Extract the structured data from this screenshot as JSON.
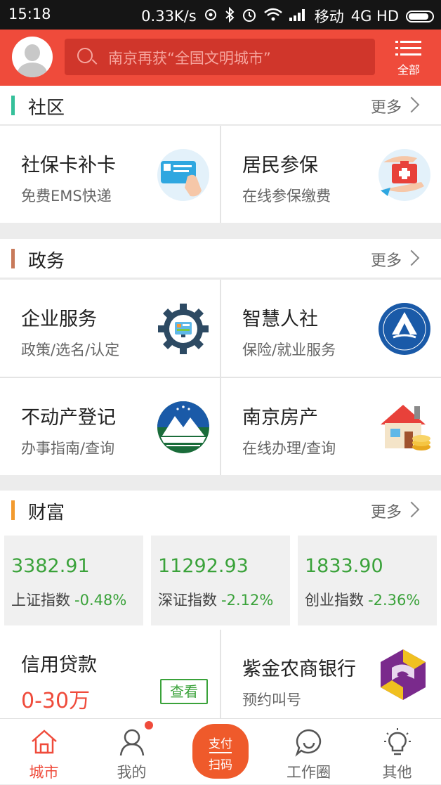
{
  "status_bar": {
    "time": "15:18",
    "net_speed": "0.33K/s",
    "carrier": "移动",
    "network": "4G HD"
  },
  "header": {
    "search_placeholder": "南京再获“全国文明城市”",
    "all_label": "全部"
  },
  "colors": {
    "brand": "#ef4b3b",
    "green": "#3aa23a",
    "orange": "#ef5a2b"
  },
  "community": {
    "title": "社区",
    "more": "更多",
    "tiles": [
      {
        "title": "社保卡补卡",
        "sub": "免费EMS快递",
        "icon": "card-hand-icon"
      },
      {
        "title": "居民参保",
        "sub": "在线参保缴费",
        "icon": "first-aid-hands-icon"
      }
    ]
  },
  "government": {
    "title": "政务",
    "more": "更多",
    "tiles": [
      {
        "title": "企业服务",
        "sub": "政策/选名/认定",
        "icon": "gear-icon"
      },
      {
        "title": "智慧人社",
        "sub": "保险/就业服务",
        "icon": "hrss-logo-icon"
      },
      {
        "title": "不动产登记",
        "sub": "办事指南/查询",
        "icon": "land-registry-logo-icon"
      },
      {
        "title": "南京房产",
        "sub": "在线办理/查询",
        "icon": "house-coins-icon"
      }
    ]
  },
  "wealth": {
    "title": "财富",
    "more": "更多",
    "indices": [
      {
        "value": "3382.91",
        "name": "上证指数",
        "change": "-0.48%"
      },
      {
        "value": "11292.93",
        "name": "深证指数",
        "change": "-2.12%"
      },
      {
        "value": "1833.90",
        "name": "创业指数",
        "change": "-2.36%"
      }
    ],
    "loan": {
      "title": "信用贷款",
      "amount": "0-30万",
      "button": "查看"
    },
    "bank": {
      "title": "紫金农商银行",
      "sub": "预约叫号",
      "icon": "zijin-bank-logo-icon"
    }
  },
  "tabbar": {
    "tabs": [
      {
        "label": "城市",
        "icon": "home-icon",
        "active": true
      },
      {
        "label": "我的",
        "icon": "user-icon"
      },
      {
        "label": "工作圈",
        "icon": "chat-icon"
      },
      {
        "label": "其他",
        "icon": "bulb-icon"
      }
    ],
    "scan": {
      "top": "支付",
      "bottom": "扫码"
    }
  }
}
